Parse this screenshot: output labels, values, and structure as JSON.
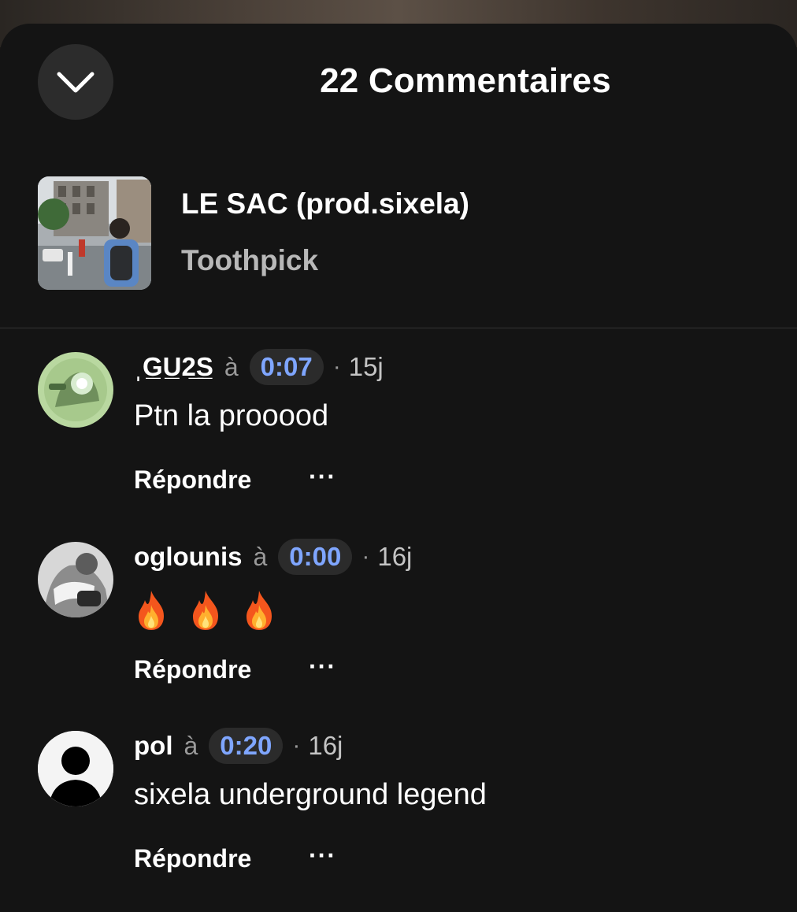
{
  "header": {
    "title": "22 Commentaires"
  },
  "track": {
    "title": "LE SAC (prod.sixela)",
    "artist": "Toothpick"
  },
  "comments": [
    {
      "username": "ˌG̲U̲2̲S̲",
      "at": "à",
      "timestamp": "0:07",
      "separator": "·",
      "age": "15j",
      "text": "Ptn la prooood",
      "reply_label": "Répondre",
      "more_label": "···"
    },
    {
      "username": "oglounis",
      "at": "à",
      "timestamp": "0:00",
      "separator": "·",
      "age": "16j",
      "text": "🔥🔥🔥",
      "reply_label": "Répondre",
      "more_label": "···"
    },
    {
      "username": "pol",
      "at": "à",
      "timestamp": "0:20",
      "separator": "·",
      "age": "16j",
      "text": "sixela underground legend",
      "reply_label": "Répondre",
      "more_label": "···"
    }
  ],
  "colors": {
    "background": "#141414",
    "timestamp_text": "#7fa6ff",
    "timestamp_bg": "#2b2b2b",
    "muted": "#9a9a9a"
  },
  "icons": {
    "close": "chevron-down-icon",
    "more": "more-horizontal-icon",
    "fire": "fire-emoji"
  }
}
